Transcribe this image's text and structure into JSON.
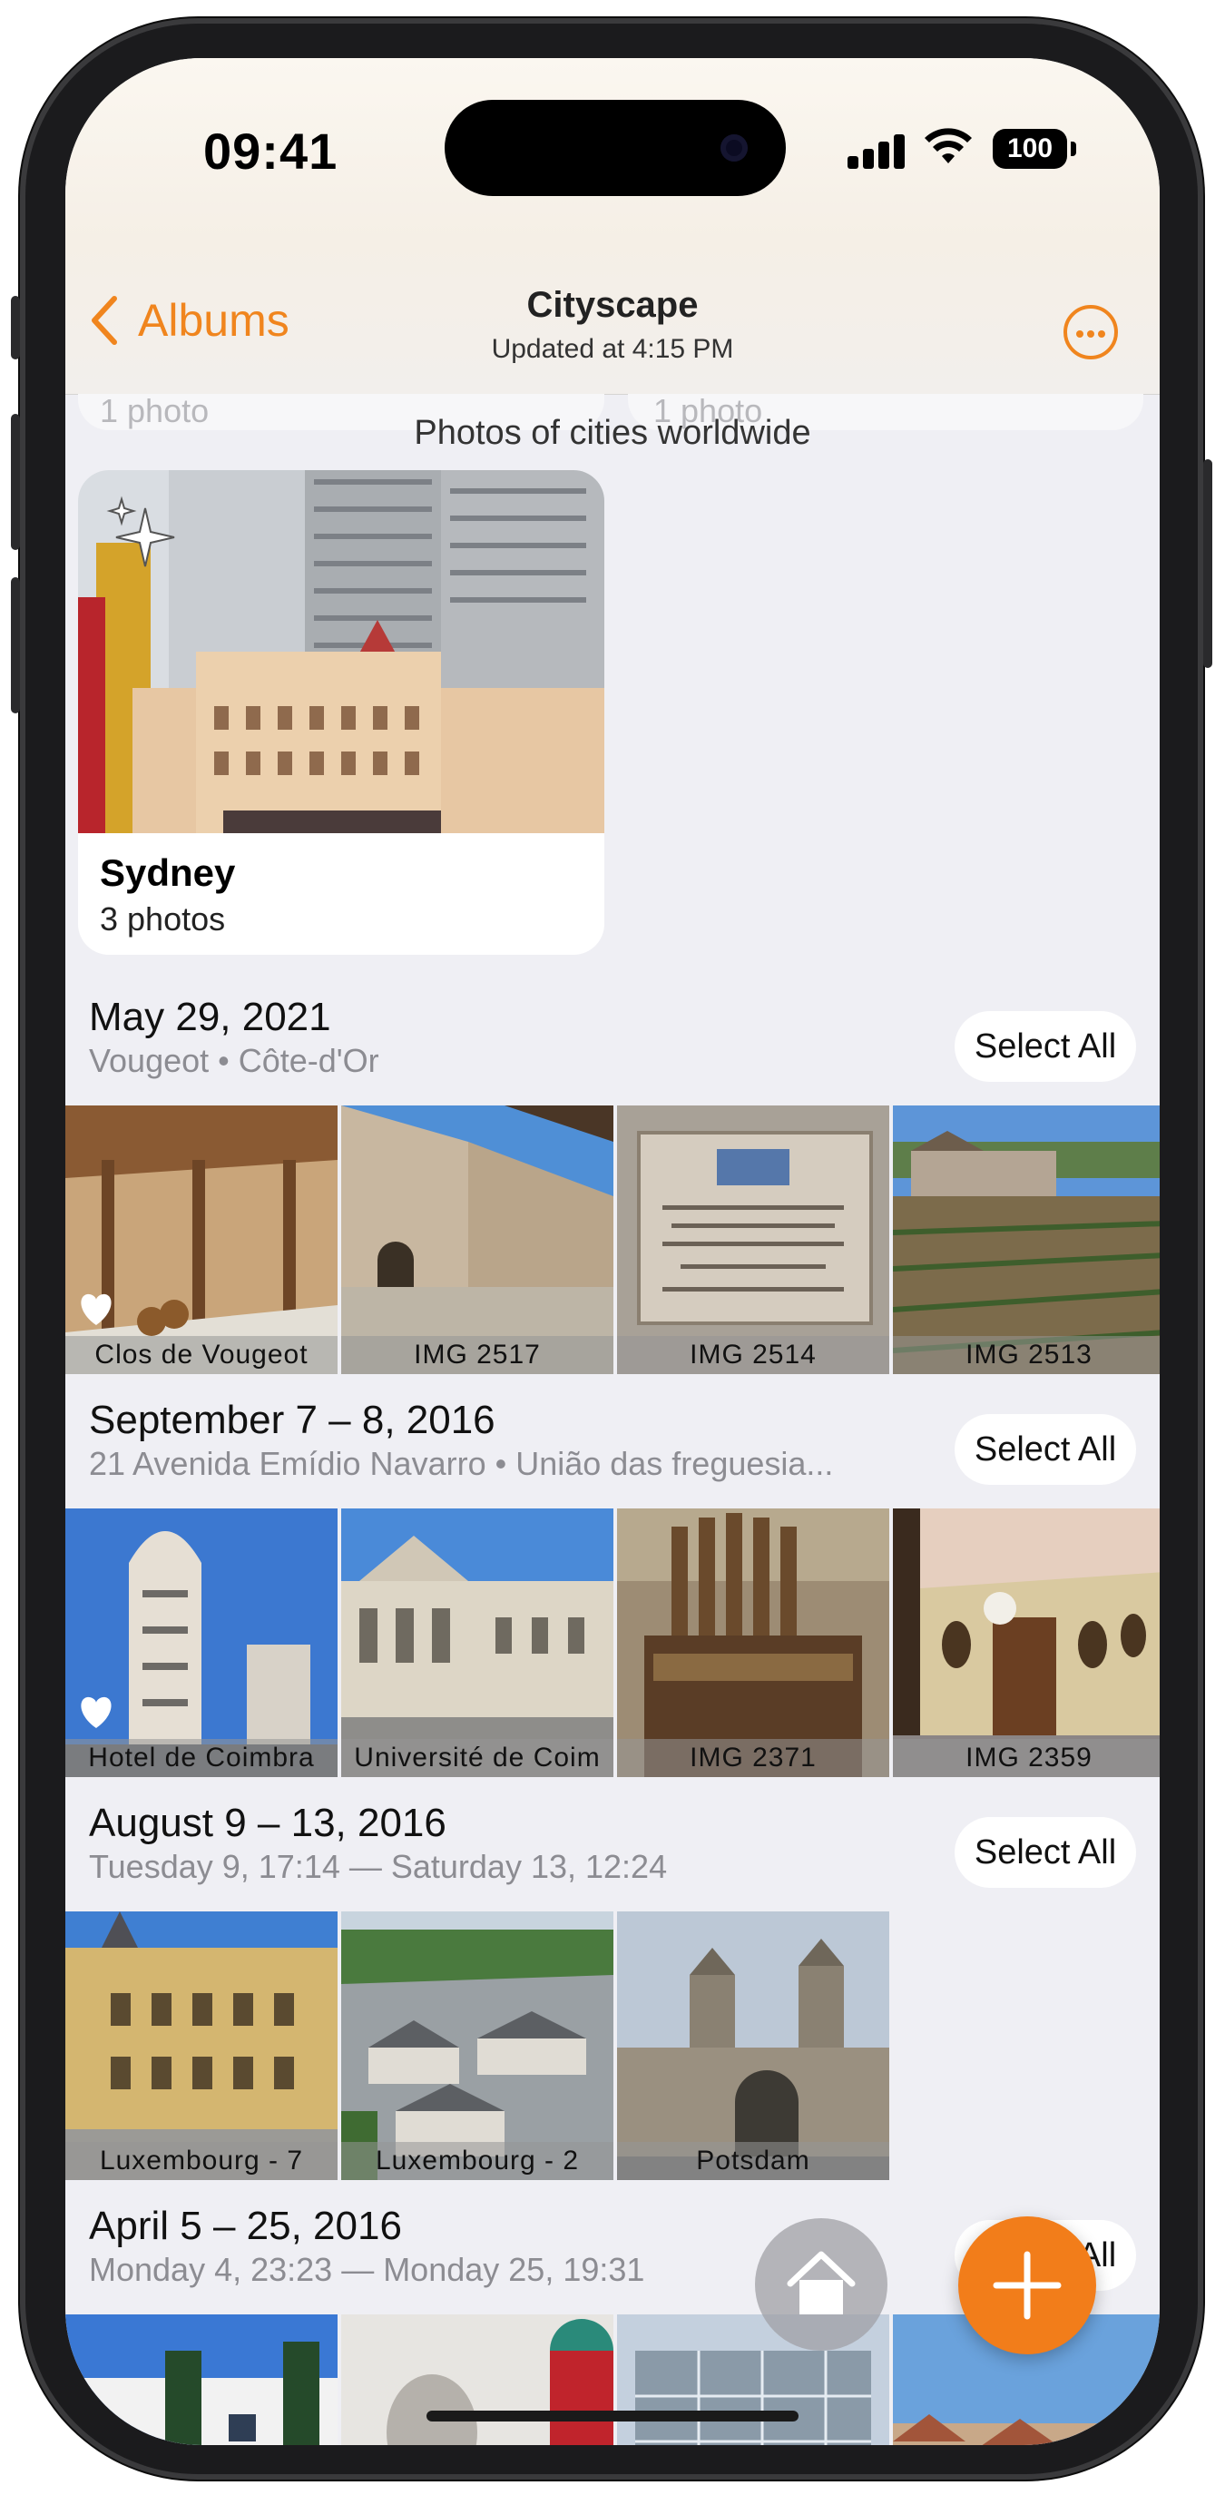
{
  "status": {
    "time": "09:41",
    "battery": "100"
  },
  "nav": {
    "back_label": "Albums",
    "title": "Cityscape",
    "subtitle": "Updated at 4:15 PM"
  },
  "ghost": {
    "left": "1 photo",
    "right": "1 photo"
  },
  "album": {
    "description": "Photos of cities worldwide",
    "name": "Sydney",
    "count": "3 photos"
  },
  "sections": [
    {
      "title": "May 29, 2021",
      "subtitle": "Vougeot • Côte-d'Or",
      "select_all": "Select All",
      "tiles": [
        {
          "caption": "Clos de Vougeot",
          "favorite": true
        },
        {
          "caption": "IMG 2517",
          "favorite": false
        },
        {
          "caption": "IMG 2514",
          "favorite": false
        },
        {
          "caption": "IMG 2513",
          "favorite": false
        }
      ]
    },
    {
      "title": "September 7 – 8, 2016",
      "subtitle": "21 Avenida Emídio Navarro • União das freguesia...",
      "select_all": "Select All",
      "tiles": [
        {
          "caption": "Hotel de Coimbra",
          "favorite": true
        },
        {
          "caption": "Université de Coim",
          "favorite": false
        },
        {
          "caption": "IMG 2371",
          "favorite": false
        },
        {
          "caption": "IMG 2359",
          "favorite": false
        }
      ]
    },
    {
      "title": "August 9 – 13, 2016",
      "subtitle": "Tuesday 9, 17:14 — Saturday 13, 12:24",
      "select_all": "Select All",
      "tiles": [
        {
          "caption": "Luxembourg - 7",
          "favorite": false
        },
        {
          "caption": "Luxembourg - 2",
          "favorite": false
        },
        {
          "caption": "Potsdam",
          "favorite": false
        }
      ]
    },
    {
      "title": "April 5 – 25, 2016",
      "subtitle": "Monday 4, 23:23 — Monday 25, 19:31",
      "select_all": "Select All",
      "tiles": []
    }
  ],
  "icons": {
    "back": "chevron-left-icon",
    "more": "ellipsis-circle-icon",
    "sparkle": "sparkles-icon",
    "favorite": "heart-icon",
    "home": "home-icon",
    "add": "plus-icon"
  },
  "colors": {
    "accent": "#f0851e",
    "add_button": "#f27d1a",
    "background": "#efeff4"
  }
}
